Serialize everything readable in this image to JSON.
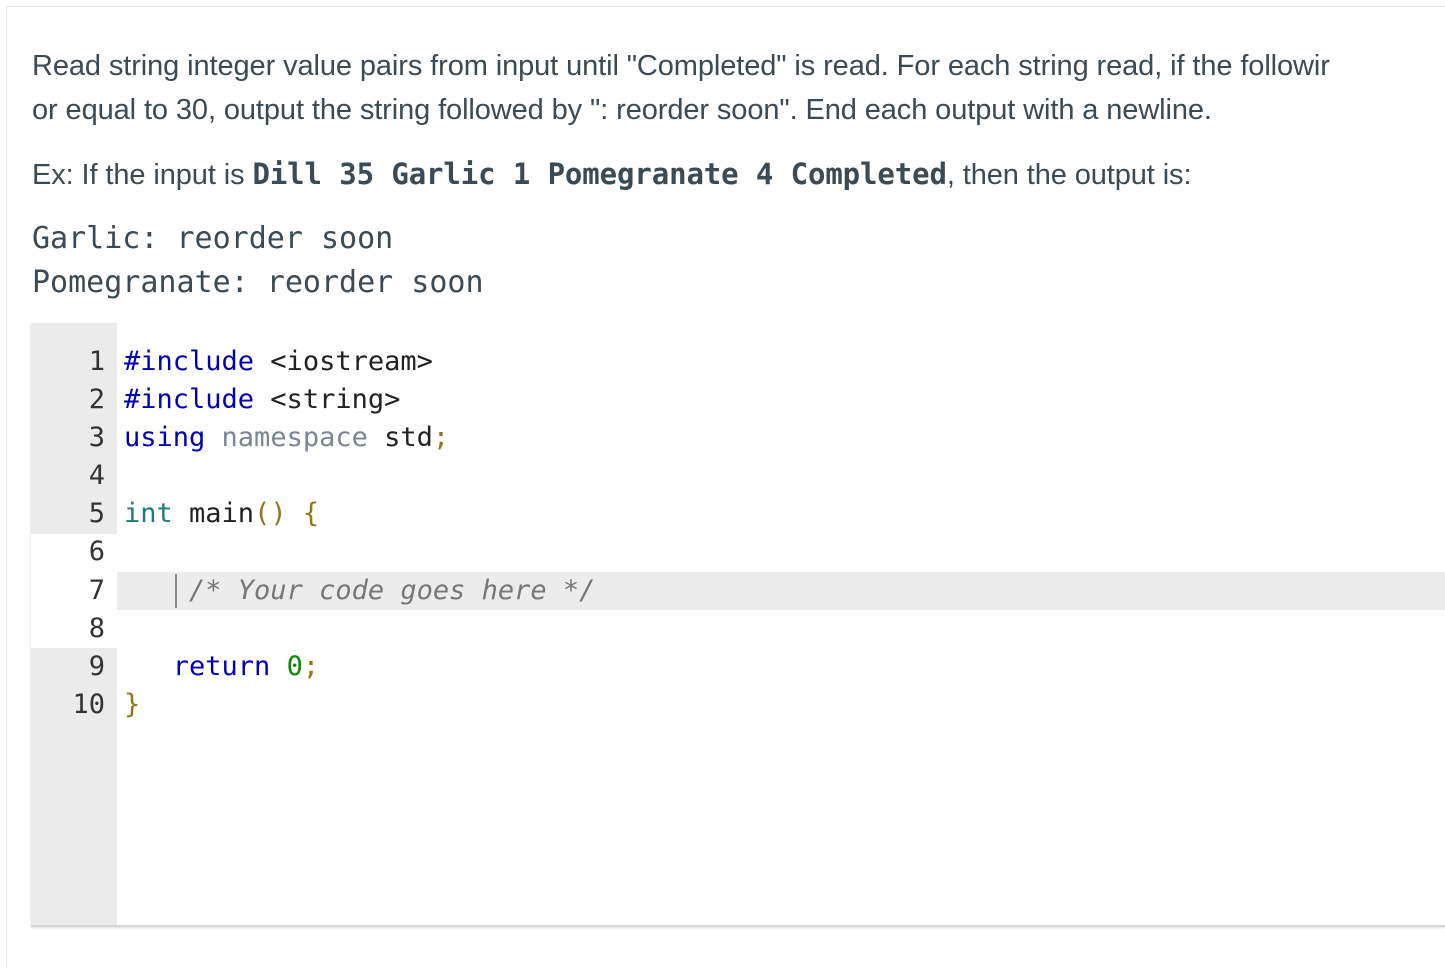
{
  "problem": {
    "para1_line1": "Read string integer value pairs from input until \"Completed\" is read. For each string read, if the followir",
    "para1_line2": "or equal to 30, output the string followed by \": reorder soon\". End each output with a newline.",
    "ex_prefix": "Ex: If the input is ",
    "ex_input": "Dill 35 Garlic 1 Pomegranate 4 Completed",
    "ex_suffix": ", then the output is:",
    "output_lines": [
      "Garlic: reorder soon",
      "Pomegranate: reorder soon"
    ]
  },
  "editor": {
    "line_numbers": [
      "1",
      "2",
      "3",
      "4",
      "5",
      "6",
      "7",
      "8",
      "9",
      "10"
    ],
    "lines": {
      "l1_kw": "#include",
      "l1_rest": " <iostream>",
      "l2_kw": "#include",
      "l2_rest": " <string>",
      "l3_kw": "using",
      "l3_ns": "namespace",
      "l3_id": "std",
      "l3_semi": ";",
      "l5_type": "int",
      "l5_fn": " main",
      "l5_paren": "()",
      "l5_brace": "{",
      "l7_comment": "/* Your code goes here */",
      "l9_kw": "return",
      "l9_num": "0",
      "l9_semi": ";",
      "l10_brace": "}"
    }
  }
}
